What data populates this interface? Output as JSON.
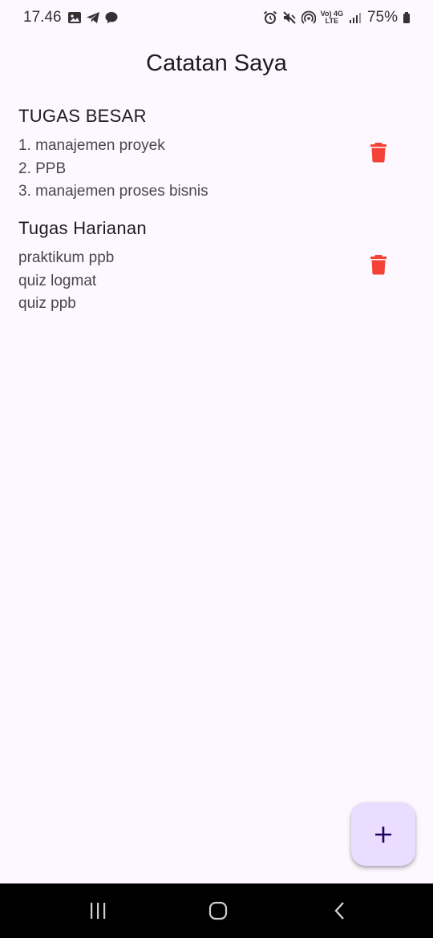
{
  "status_bar": {
    "time": "17.46",
    "battery": "75%",
    "network_top": "Vo) 4G",
    "network_bottom": "LTE",
    "left_icons": [
      "image-icon",
      "telegram-icon",
      "chat-icon"
    ],
    "right_icons": [
      "alarm-icon",
      "mute-icon",
      "hotspot-icon",
      "signal-icon",
      "battery-icon"
    ]
  },
  "app_bar": {
    "title": "Catatan Saya"
  },
  "notes": [
    {
      "title": "TUGAS BESAR",
      "content": "1. manajemen proyek\n2. PPB\n3. manajemen proses bisnis",
      "delete_icon": "trash-icon"
    },
    {
      "title": "Tugas Harianan",
      "content": "praktikum ppb\nquiz logmat\nquiz ppb",
      "delete_icon": "trash-icon"
    }
  ],
  "fab": {
    "icon": "plus-icon"
  },
  "nav_bar": {
    "icons": [
      "recent-apps-icon",
      "home-icon",
      "back-icon"
    ]
  },
  "colors": {
    "background": "#fdf7ff",
    "delete": "#f44336",
    "fab_background": "#eaddff",
    "fab_icon": "#21005d",
    "nav_background": "#000000"
  }
}
